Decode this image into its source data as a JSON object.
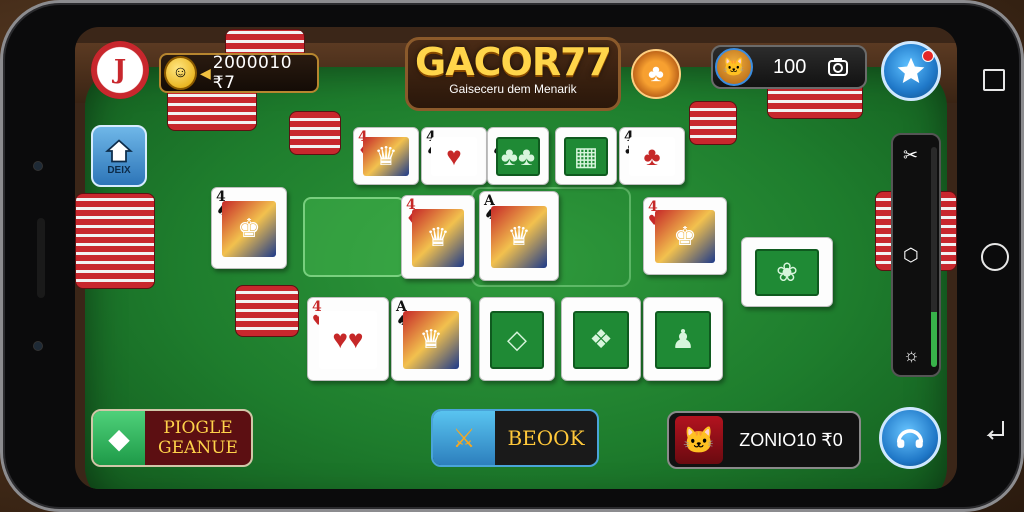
{
  "app": {
    "logo_title": "GACOR77",
    "logo_subtitle": "Gaiseceru dem Menarik"
  },
  "top_bar": {
    "badge_glyph": "J",
    "coin_face": "☺",
    "coin_arrow": "◀",
    "coins": "2000010 ₹7",
    "gem_glyph": "♣",
    "score_avatar": "🐱",
    "score": "100"
  },
  "home_button": {
    "label": "DEIX"
  },
  "slider": {
    "level_percent": 25
  },
  "cards": {
    "top_row": [
      {
        "rank": "4",
        "suit": "♦",
        "color": "red",
        "art": "♛"
      },
      {
        "rank": "4",
        "suit": "♠",
        "color": "black",
        "art": "♥"
      },
      {
        "rank": "",
        "suit": "♠",
        "color": "green",
        "art": "♣♣"
      },
      {
        "rank": "",
        "suit": "",
        "color": "green",
        "art": "▦"
      },
      {
        "rank": "4",
        "suit": "♣",
        "color": "black",
        "art": "♣"
      }
    ],
    "middle_row": [
      {
        "rank": "4",
        "suit": "♠",
        "color": "black",
        "art": "♚"
      },
      {
        "rank": "4",
        "suit": "♦",
        "color": "red",
        "art": "♛"
      },
      {
        "rank": "A",
        "suit": "♠",
        "color": "black",
        "art": "♛"
      },
      {
        "rank": "4",
        "suit": "♥",
        "color": "red",
        "art": "♚"
      },
      {
        "rank": "",
        "suit": "",
        "color": "green",
        "art": "❀"
      }
    ],
    "bottom_row": [
      {
        "rank": "4",
        "suit": "♥",
        "color": "red",
        "art": "♥♥"
      },
      {
        "rank": "A",
        "suit": "♠",
        "color": "black",
        "art": "♛"
      },
      {
        "rank": "",
        "suit": "",
        "color": "green",
        "art": "◇"
      },
      {
        "rank": "",
        "suit": "",
        "color": "green",
        "art": "❖"
      },
      {
        "rank": "",
        "suit": "",
        "color": "green",
        "art": "♟"
      }
    ]
  },
  "bottom_bar": {
    "left_label_1": "PIOGLE",
    "left_label_2": "GEANUE",
    "mid_label": "BEOOK",
    "right_label": "ZONIO10 ₹0",
    "right_avatar": "🐱"
  },
  "colors": {
    "felt": "#1e7d2d",
    "chip_red": "#c8272d",
    "accent_gold": "#ffd54a",
    "accent_blue": "#1f78c8"
  },
  "icons": {
    "badge": "joker-badge-icon",
    "coin": "coin-icon",
    "gem": "clover-gem-icon",
    "star": "star-icon",
    "home": "home-icon",
    "camera": "camera-icon",
    "sword": "sword-icon",
    "chat": "chat-icon",
    "nav_recent": "square-icon",
    "nav_home": "circle-icon",
    "nav_back": "back-icon"
  }
}
